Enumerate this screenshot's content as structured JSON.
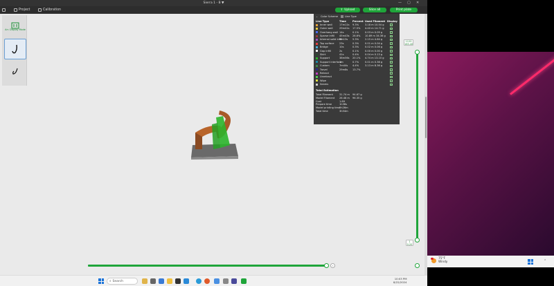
{
  "window": {
    "title": "Sierra 1 - B ▼"
  },
  "appbar": {
    "project_label": "Project",
    "calibration_label": "Calibration",
    "upload_label": "Upload",
    "slice_all_label": "Slice all",
    "print_plate_label": "Print plate"
  },
  "toolstrip": {
    "auto_arrange_label": "Arr. Display Mode"
  },
  "legend": {
    "scheme_label": "Color Scheme",
    "scheme_value": "Line Type",
    "columns": [
      "Line Type",
      "Time",
      "Percent",
      "Used Filament",
      "Display"
    ],
    "rows": [
      {
        "name": "Inner wall",
        "color": "#e8a33b",
        "time": "17m11s",
        "pct": "9.3%",
        "filament": "3.18 m   10.54 g"
      },
      {
        "name": "Outer wall",
        "color": "#f0d040",
        "time": "29m41s",
        "pct": "17.5%",
        "filament": "4.40 m   14.71 g"
      },
      {
        "name": "Overhang wall",
        "color": "#4a6cf0",
        "time": "14s",
        "pct": "0.1%",
        "filament": "0.03 m   0.09 g"
      },
      {
        "name": "Sparse infill",
        "color": "#9e3a3a",
        "time": "45m43s",
        "pct": "26.6%",
        "filament": "10.89 m   34.36 g"
      },
      {
        "name": "Internal solid infill",
        "color": "#a050c8",
        "time": "9m13s",
        "pct": "5.3%",
        "filament": "2.15 m   4.64 g"
      },
      {
        "name": "Top surface",
        "color": "#e84040",
        "time": "23s",
        "pct": "0.3%",
        "filament": "0.01 m   0.04 g"
      },
      {
        "name": "Bridge",
        "color": "#4ab0d8",
        "time": "10s",
        "pct": "0.3%",
        "filament": "0.02 m   0.06 g"
      },
      {
        "name": "Gap infill",
        "color": "#ffffff",
        "time": "2s",
        "pct": "0.1%",
        "filament": "0.00 m   0.00 g"
      },
      {
        "name": "Skirt",
        "color": "#2a4a30",
        "time": "41s",
        "pct": "0.4%",
        "filament": "0.04 m   0.13 g"
      },
      {
        "name": "Support",
        "color": "#2bb52b",
        "time": "38m56s",
        "pct": "20.1%",
        "filament": "4.74 m   13.10 g"
      },
      {
        "name": "Support interface",
        "color": "#1a8aa8",
        "time": "1m",
        "pct": "0.7%",
        "filament": "0.01 m   0.36 g"
      },
      {
        "name": "Custom",
        "color": "#3a8a50",
        "time": "7m44s",
        "pct": "4.4%",
        "filament": "3.13 m   8.36 g"
      },
      {
        "name": "Travel",
        "color": "#2a2a8a",
        "time": "29m8s",
        "pct": "13.7%",
        "filament": ""
      },
      {
        "name": "Retract",
        "color": "#c040c0",
        "time": "",
        "pct": "",
        "filament": ""
      },
      {
        "name": "Unretract",
        "color": "#50d050",
        "time": "",
        "pct": "",
        "filament": ""
      },
      {
        "name": "Wipe",
        "color": "#e0e040",
        "time": "",
        "pct": "",
        "filament": ""
      },
      {
        "name": "Seams",
        "color": "#d0d0d0",
        "time": "",
        "pct": "",
        "filament": ""
      }
    ],
    "estimation_title": "Total Estimation",
    "estimation": [
      {
        "label": "Total Filament",
        "a": "31.74 m",
        "b": "94.67 g"
      },
      {
        "label": "Model Filament",
        "a": "26.48 m",
        "b": "96.35 g"
      },
      {
        "label": "Cost",
        "a": "1.89",
        "b": ""
      },
      {
        "label": "Prepare time",
        "a": "1h38s",
        "b": ""
      },
      {
        "label": "Model printing time",
        "a": "2h26m",
        "b": ""
      },
      {
        "label": "Total time",
        "a": "3h54m",
        "b": ""
      }
    ]
  },
  "sliders": {
    "top_tag": "1120\n165.40",
    "bottom_tag": "1\n0.20",
    "horizontal_level": 1.0,
    "vertical_level": 1.0
  },
  "taskbar": {
    "search_placeholder": "Search",
    "time": "10:03 PM",
    "date": "8/22/2024"
  },
  "right_taskbar": {
    "temp": "75°F",
    "condition": "Windy"
  },
  "colors": {
    "accent": "#1fa53a",
    "legend_bg": "#3a3a3a"
  }
}
